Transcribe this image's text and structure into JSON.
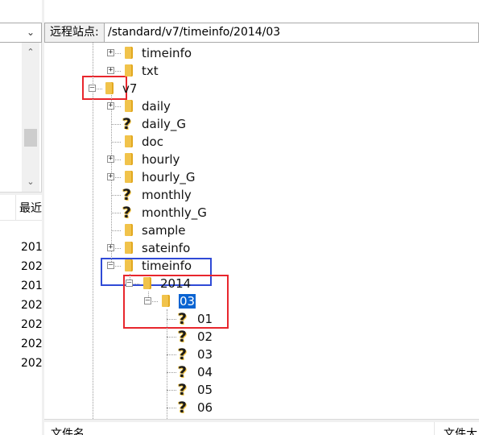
{
  "local": {
    "header_first_col": "最近",
    "rows": [
      "201",
      "202",
      "201",
      "202",
      "202",
      "202",
      "202"
    ]
  },
  "remote": {
    "site_label": "远程站点:",
    "path": "/standard/v7/timeinfo/2014/03",
    "tree": [
      {
        "label": "timeinfo",
        "icon": "folder-icon",
        "expander": "+"
      },
      {
        "label": "txt",
        "icon": "folder-icon",
        "expander": "+"
      },
      {
        "label": "v7",
        "icon": "folder-icon",
        "expander": "-"
      },
      {
        "label": "daily",
        "icon": "folder-icon",
        "expander": "+"
      },
      {
        "label": "daily_G",
        "icon": "unknown-icon",
        "expander": ""
      },
      {
        "label": "doc",
        "icon": "folder-icon",
        "expander": ""
      },
      {
        "label": "hourly",
        "icon": "folder-icon",
        "expander": "+"
      },
      {
        "label": "hourly_G",
        "icon": "folder-icon",
        "expander": "+"
      },
      {
        "label": "monthly",
        "icon": "unknown-icon",
        "expander": ""
      },
      {
        "label": "monthly_G",
        "icon": "unknown-icon",
        "expander": ""
      },
      {
        "label": "sample",
        "icon": "folder-icon",
        "expander": ""
      },
      {
        "label": "sateinfo",
        "icon": "folder-icon",
        "expander": "+"
      },
      {
        "label": "timeinfo",
        "icon": "folder-icon",
        "expander": "-"
      },
      {
        "label": "2014",
        "icon": "folder-icon",
        "expander": "-"
      },
      {
        "label": "03",
        "icon": "folder-icon",
        "expander": "-",
        "selected": true
      },
      {
        "label": "01",
        "icon": "unknown-icon",
        "expander": ""
      },
      {
        "label": "02",
        "icon": "unknown-icon",
        "expander": ""
      },
      {
        "label": "03",
        "icon": "unknown-icon",
        "expander": ""
      },
      {
        "label": "04",
        "icon": "unknown-icon",
        "expander": ""
      },
      {
        "label": "05",
        "icon": "unknown-icon",
        "expander": ""
      },
      {
        "label": "06",
        "icon": "unknown-icon",
        "expander": ""
      }
    ],
    "list_headers": [
      "文件名",
      "文件大"
    ]
  },
  "colors": {
    "highlight_red": "#e8262d",
    "highlight_blue": "#2f4ad6",
    "selection": "#0a64d2",
    "folder": "#f1c34b"
  }
}
